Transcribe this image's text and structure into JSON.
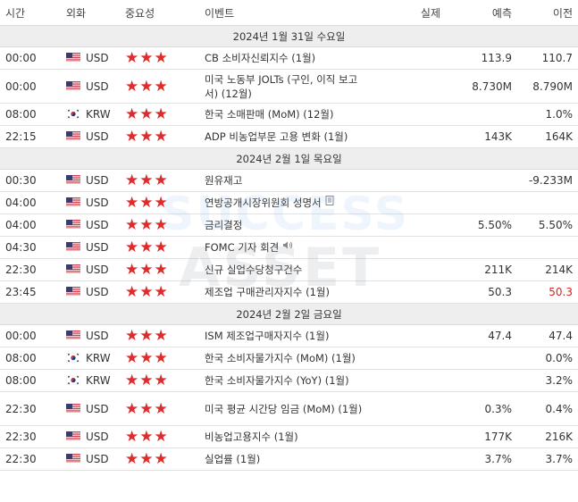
{
  "headers": {
    "time": "시간",
    "currency": "외화",
    "importance": "중요성",
    "event": "이벤트",
    "actual": "실제",
    "forecast": "예측",
    "previous": "이전"
  },
  "colors": {
    "star": "#e02b2b",
    "red_value": "#d8261d",
    "date_bg": "#eeeeee"
  },
  "watermark": {
    "line1": "SUCCESS",
    "line2": "ASSET"
  },
  "sections": [
    {
      "date": "2024년 1월 31일 수요일",
      "rows": [
        {
          "time": "00:00",
          "flag": "us",
          "currency": "USD",
          "stars": "★★★",
          "event": "CB 소비자신뢰지수 (1월)",
          "actual": "",
          "forecast": "113.9",
          "previous": "110.7"
        },
        {
          "time": "00:00",
          "flag": "us",
          "currency": "USD",
          "stars": "★★★",
          "event": "미국 노동부 JOLTs (구인, 이직 보고서) (12월)",
          "actual": "",
          "forecast": "8.730M",
          "previous": "8.790M"
        },
        {
          "time": "08:00",
          "flag": "kr",
          "currency": "KRW",
          "stars": "★★★",
          "event": "한국 소매판매 (MoM) (12월)",
          "actual": "",
          "forecast": "",
          "previous": "1.0%"
        },
        {
          "time": "22:15",
          "flag": "us",
          "currency": "USD",
          "stars": "★★★",
          "event": "ADP 비농업부문 고용 변화 (1월)",
          "actual": "",
          "forecast": "143K",
          "previous": "164K"
        }
      ]
    },
    {
      "date": "2024년 2월 1일 목요일",
      "rows": [
        {
          "time": "00:30",
          "flag": "us",
          "currency": "USD",
          "stars": "★★★",
          "event": "원유재고",
          "actual": "",
          "forecast": "",
          "previous": "-9.233M"
        },
        {
          "time": "04:00",
          "flag": "us",
          "currency": "USD",
          "stars": "★★★",
          "event": "연방공개시장위원회 성명서",
          "actual": "",
          "forecast": "",
          "previous": "",
          "icon": "document-icon"
        },
        {
          "time": "04:00",
          "flag": "us",
          "currency": "USD",
          "stars": "★★★",
          "event": "금리결정",
          "actual": "",
          "forecast": "5.50%",
          "previous": "5.50%"
        },
        {
          "time": "04:30",
          "flag": "us",
          "currency": "USD",
          "stars": "★★★",
          "event": "FOMC 기자 회견",
          "actual": "",
          "forecast": "",
          "previous": "",
          "icon": "speaker-icon"
        },
        {
          "time": "22:30",
          "flag": "us",
          "currency": "USD",
          "stars": "★★★",
          "event": "신규 실업수당청구건수",
          "actual": "",
          "forecast": "211K",
          "previous": "214K"
        },
        {
          "time": "23:45",
          "flag": "us",
          "currency": "USD",
          "stars": "★★★",
          "event": "제조업 구매관리자지수 (1월)",
          "actual": "",
          "forecast": "50.3",
          "previous": "50.3",
          "previous_red": true
        }
      ]
    },
    {
      "date": "2024년 2월 2일 금요일",
      "rows": [
        {
          "time": "00:00",
          "flag": "us",
          "currency": "USD",
          "stars": "★★★",
          "event": "ISM 제조업구매자지수 (1월)",
          "actual": "",
          "forecast": "47.4",
          "previous": "47.4"
        },
        {
          "time": "08:00",
          "flag": "kr",
          "currency": "KRW",
          "stars": "★★★",
          "event": "한국 소비자물가지수 (MoM) (1월)",
          "actual": "",
          "forecast": "",
          "previous": "0.0%"
        },
        {
          "time": "08:00",
          "flag": "kr",
          "currency": "KRW",
          "stars": "★★★",
          "event": "한국 소비자물가지수 (YoY) (1월)",
          "actual": "",
          "forecast": "",
          "previous": "3.2%"
        },
        {
          "time": "22:30",
          "flag": "us",
          "currency": "USD",
          "stars": "★★★",
          "event": "미국 평균 시간당 임금 (MoM) (1월)",
          "actual": "",
          "forecast": "0.3%",
          "previous": "0.4%"
        },
        {
          "time": "22:30",
          "flag": "us",
          "currency": "USD",
          "stars": "★★★",
          "event": "비농업고용지수 (1월)",
          "actual": "",
          "forecast": "177K",
          "previous": "216K"
        },
        {
          "time": "22:30",
          "flag": "us",
          "currency": "USD",
          "stars": "★★★",
          "event": "실업률 (1월)",
          "actual": "",
          "forecast": "3.7%",
          "previous": "3.7%"
        }
      ]
    }
  ]
}
